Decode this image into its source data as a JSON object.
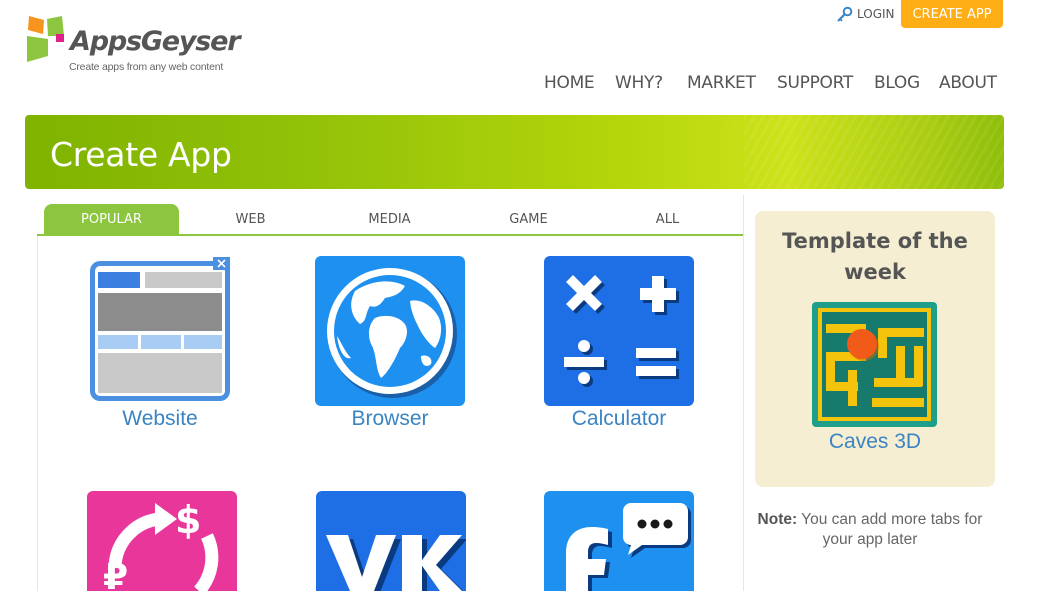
{
  "header": {
    "logo_title": "AppsGeyser",
    "logo_tagline": "Create apps from any web content",
    "login_label": "LOGIN",
    "create_app_label": "CREATE APP",
    "nav": [
      "HOME",
      "WHY?",
      "MARKET",
      "SUPPORT",
      "BLOG",
      "ABOUT"
    ]
  },
  "banner": {
    "title": "Create App"
  },
  "tabs": {
    "items": [
      "POPULAR",
      "WEB",
      "MEDIA",
      "GAME",
      "ALL"
    ],
    "active": "POPULAR"
  },
  "apps": [
    {
      "label": "Website",
      "icon": "website-icon"
    },
    {
      "label": "Browser",
      "icon": "globe-icon"
    },
    {
      "label": "Calculator",
      "icon": "calculator-icon"
    },
    {
      "label": "",
      "icon": "currency-exchange-icon"
    },
    {
      "label": "",
      "icon": "vk-icon"
    },
    {
      "label": "",
      "icon": "facebook-messenger-icon"
    }
  ],
  "sidebar": {
    "template_title": "Template of the week",
    "template_name": "Caves 3D",
    "template_icon": "maze-game-icon",
    "note_bold": "Note:",
    "note_text": " You can add more tabs for your app later"
  },
  "colors": {
    "accent_green": "#8cc63f",
    "cta_orange": "#ffad14",
    "link_blue": "#3a84c4",
    "icon_blue": "#1e90f0",
    "pink": "#e9369a",
    "sidebar_bg": "#f5eed3"
  }
}
